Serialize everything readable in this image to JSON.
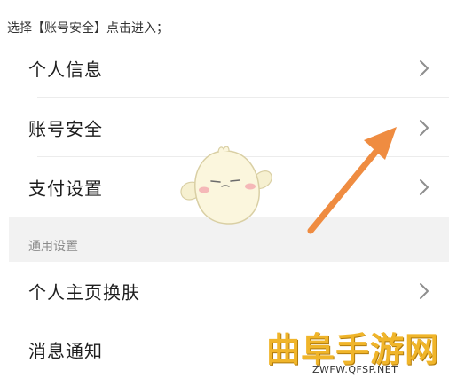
{
  "instruction": "选择【账号安全】点击进入；",
  "account_menu": {
    "items": [
      {
        "label": "个人信息",
        "icon": "chevron-right-icon"
      },
      {
        "label": "账号安全",
        "icon": "chevron-right-icon"
      },
      {
        "label": "支付设置",
        "icon": "chevron-right-icon"
      }
    ]
  },
  "general_section": {
    "header": "通用设置",
    "items": [
      {
        "label": "个人主页换肤",
        "icon": "chevron-right-icon"
      },
      {
        "label": "消息通知"
      }
    ]
  },
  "annotation": {
    "arrow_color": "#ef8c41",
    "arrow_icon": "pointer-arrow-icon"
  },
  "watermark": {
    "brand": "曲阜手游网",
    "url": "ZWFW.QFSP.NET",
    "color": "#f0b52a"
  }
}
